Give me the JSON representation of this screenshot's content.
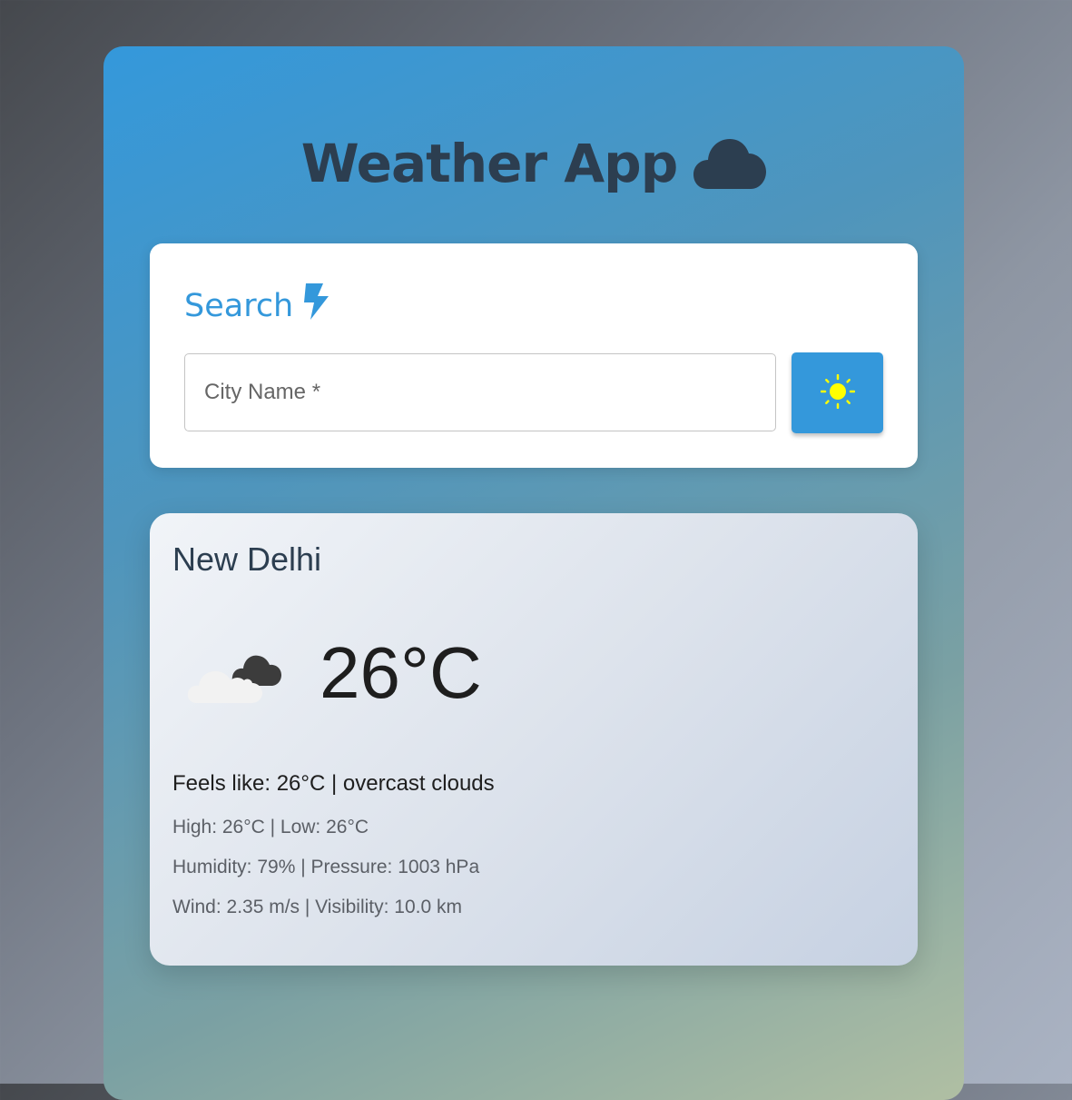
{
  "app": {
    "title": "Weather App",
    "title_icon": "cloud-icon"
  },
  "search": {
    "heading": "Search",
    "heading_icon": "lightning-bolt-icon",
    "input_placeholder": "City Name *",
    "input_value": "",
    "button_icon": "sun-icon"
  },
  "weather": {
    "city": "New Delhi",
    "condition_icon": "overcast-clouds-icon",
    "temperature": "26°C",
    "feels_like_line": "Feels like: 26°C | overcast clouds",
    "high_low_line": "High: 26°C | Low: 26°C",
    "humidity_pressure_line": "Humidity: 79% | Pressure: 1003 hPa",
    "wind_visibility_line": "Wind: 2.35 m/s | Visibility: 10.0 km"
  },
  "colors": {
    "accent": "#3498db",
    "title_text": "#2c3e50",
    "sun_icon": "#ffff00"
  }
}
